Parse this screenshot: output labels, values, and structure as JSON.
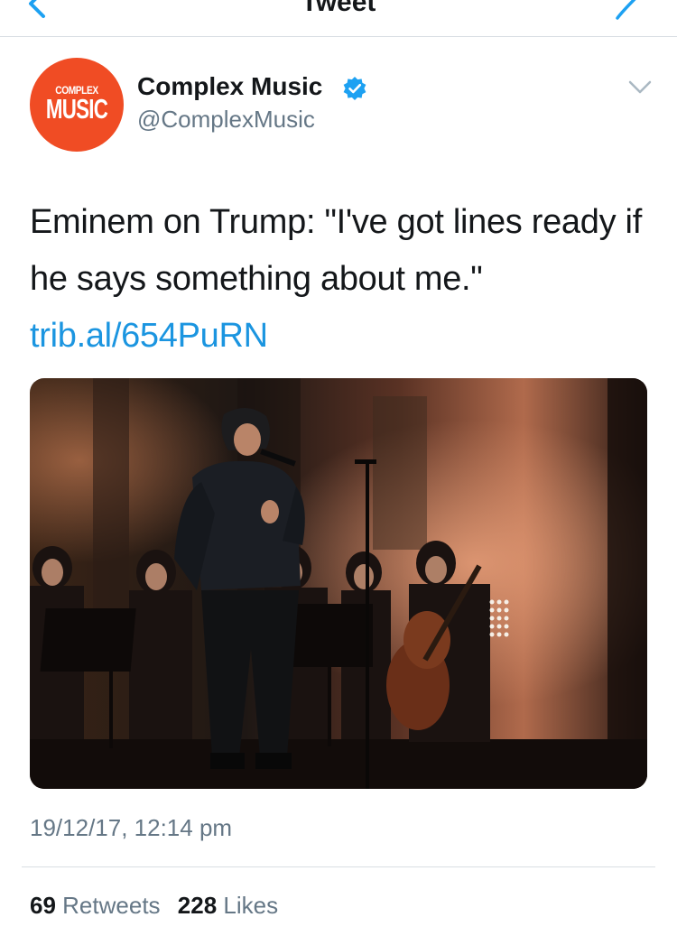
{
  "nav": {
    "title": "Tweet"
  },
  "author": {
    "avatar_text_top": "COMPLEX",
    "avatar_text_bottom": "MUSIC",
    "display_name": "Complex Music",
    "handle": "@ComplexMusic",
    "verified": true
  },
  "tweet": {
    "text": "Eminem on Trump: \"I've got lines ready if he says something about me.\" ",
    "link": "trib.al/654PuRN",
    "timestamp": "19/12/17, 12:14 pm"
  },
  "stats": {
    "retweets_count": "69",
    "retweets_label": "Retweets",
    "likes_count": "228",
    "likes_label": "Likes"
  },
  "colors": {
    "accent": "#1b95e0",
    "avatar_bg": "#f04c24",
    "secondary_text": "#657786"
  },
  "icons": [
    "back-arrow-icon",
    "compose-icon",
    "verified-icon",
    "chevron-down-icon"
  ]
}
